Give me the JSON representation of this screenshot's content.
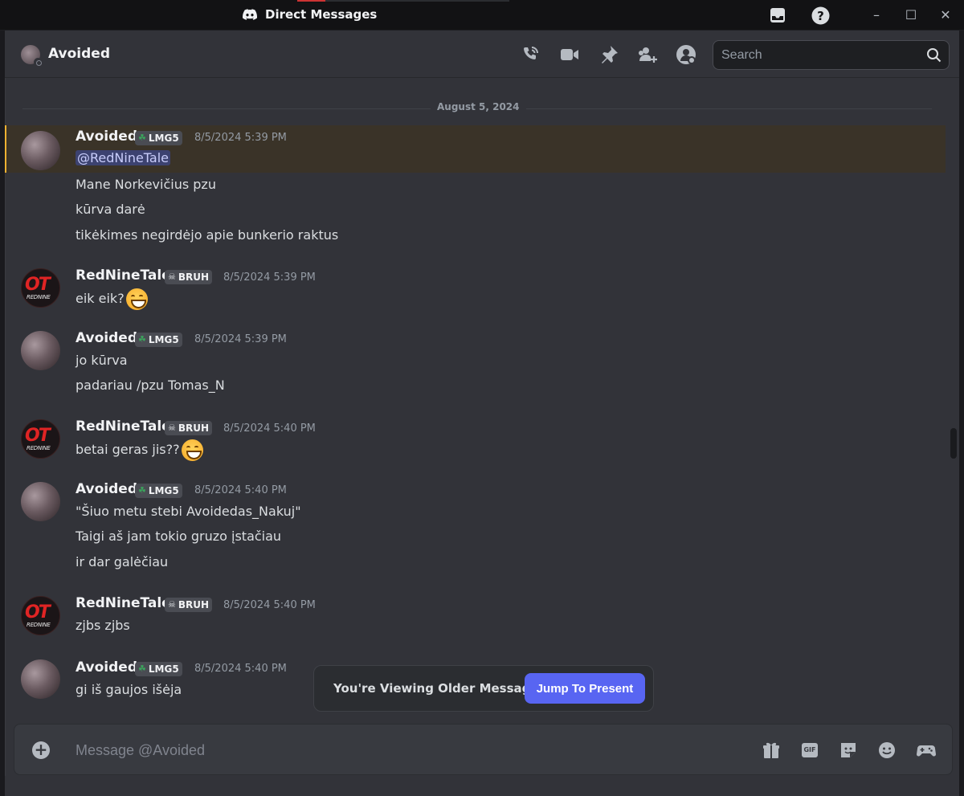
{
  "window": {
    "title": "Direct Messages",
    "controls": {
      "minimize": "–",
      "maximize": "☐",
      "close": "✕"
    }
  },
  "header": {
    "name": "Avoided",
    "search_placeholder": "Search",
    "icons": [
      "phone-call-icon",
      "video-call-icon",
      "pin-icon",
      "add-friend-icon",
      "user-profile-icon"
    ]
  },
  "conversation": {
    "date_divider": "August 5, 2024",
    "messages": [
      {
        "author": "Avoided",
        "tag": "LMG5",
        "time": "8/5/2024 5:39 PM",
        "mention": "@RedNineTale",
        "lines": [
          "Mane Norkevičius pzu",
          "kūrva darė",
          "tikėkimes negirdėjo apie bunkerio raktus"
        ]
      },
      {
        "author": "RedNineTale",
        "tag": "BRUH",
        "time": "8/5/2024 5:39 PM",
        "lines": [
          "eik eik?"
        ]
      },
      {
        "author": "Avoided",
        "tag": "LMG5",
        "time": "8/5/2024 5:39 PM",
        "lines": [
          "jo kūrva",
          "padariau /pzu Tomas_N"
        ]
      },
      {
        "author": "RedNineTale",
        "tag": "BRUH",
        "time": "8/5/2024 5:40 PM",
        "lines": [
          "betai geras jis??"
        ]
      },
      {
        "author": "Avoided",
        "tag": "LMG5",
        "time": "8/5/2024 5:40 PM",
        "lines": [
          "\"Šiuo metu stebi Avoidedas_Nakuj\"",
          "Taigi aš jam tokio gruzo įstačiau",
          "ir dar galėčiau"
        ]
      },
      {
        "author": "RedNineTale",
        "tag": "BRUH",
        "time": "8/5/2024 5:40 PM",
        "lines": [
          "zjbs zjbs"
        ]
      },
      {
        "author": "Avoided",
        "tag": "LMG5",
        "time": "8/5/2024 5:40 PM",
        "lines": [
          "gi iš gaujos išėja"
        ]
      }
    ]
  },
  "avatar_text": {
    "ot": "OT",
    "rn": "REDNINE"
  },
  "older_banner": {
    "text": "You're Viewing Older Messages",
    "button": "Jump To Present"
  },
  "composer": {
    "placeholder": "Message @Avoided",
    "gif_label": "GIF"
  },
  "colors": {
    "accent": "#5865f2",
    "highlight_bar": "#f0b232",
    "mention_bg": "#3c4270",
    "background": "#323339"
  }
}
